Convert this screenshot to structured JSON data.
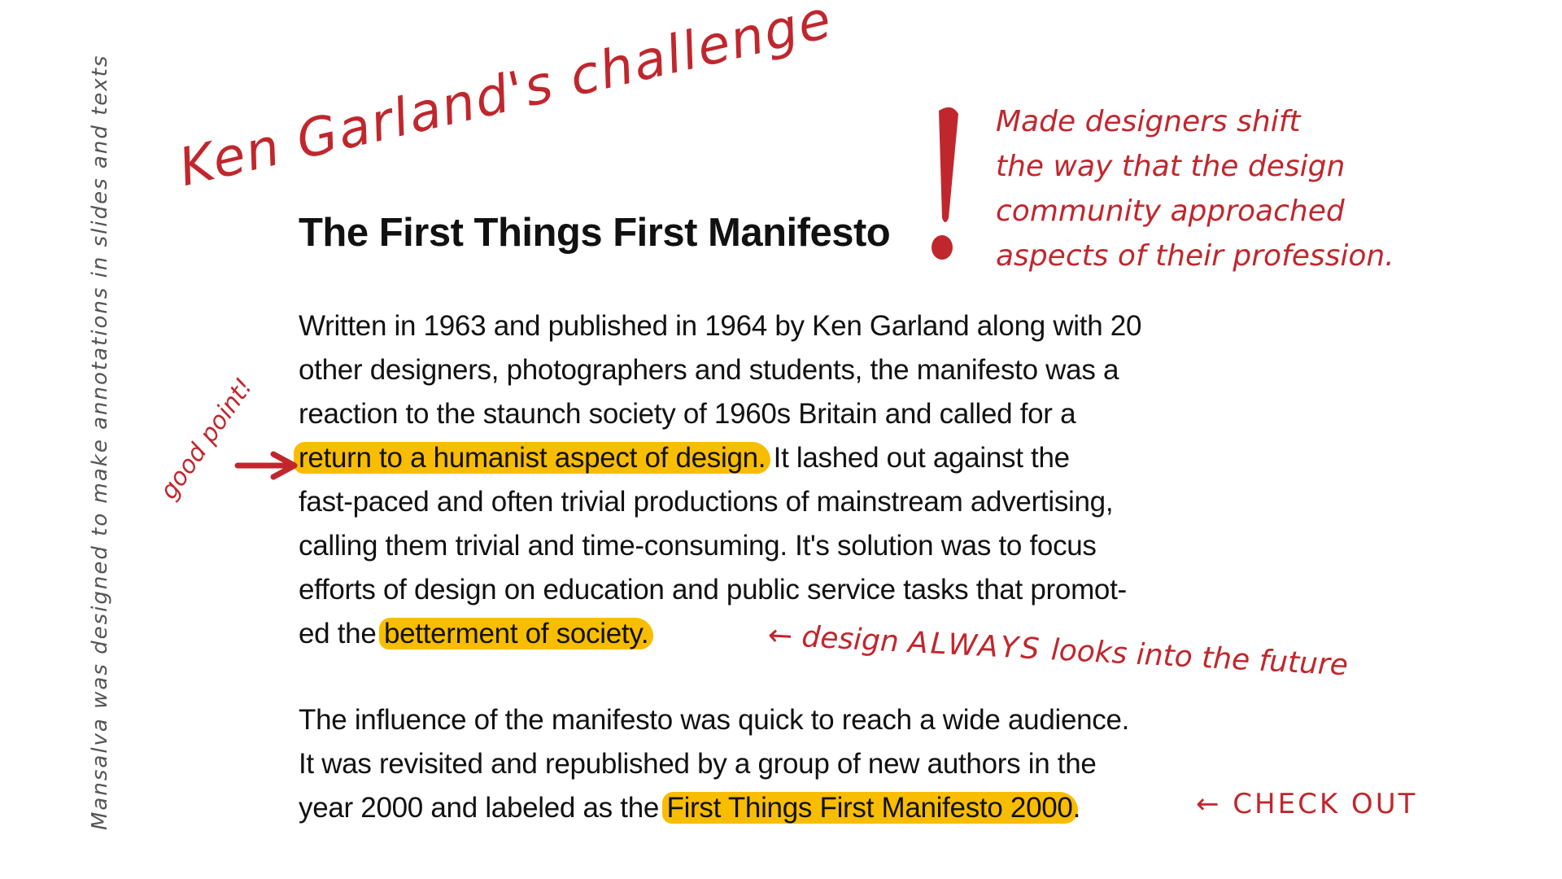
{
  "side_note": "Mansalva was designed to make annotations in slides and texts",
  "handwritten_title": "Ken Garland's challenge",
  "heading": "The First Things First Manifesto",
  "margin_note": {
    "lines": [
      "Made designers shift",
      "the way that the design",
      "community approached",
      "aspects of their profession."
    ]
  },
  "paragraph1": {
    "l1": "Written in 1963 and published in 1964 by Ken Garland along with 20",
    "l2": "other designers, photographers and students, the manifesto was a",
    "l3": "reaction to the staunch society of 1960s Britain and called for a",
    "l4_highlight": "return to a humanist aspect of design.",
    "l4_rest": " It lashed out against the",
    "l5": "fast-paced and often trivial productions of mainstream advertising,",
    "l6": "calling them trivial and time-consuming. It's solution was to focus",
    "l7": "efforts of design on education and public service tasks that promot-",
    "l8_pre": "ed the ",
    "l8_highlight": "betterment of society."
  },
  "paragraph2": {
    "l1": "The influence of the manifesto was quick to reach a wide audience.",
    "l2": "It was revisited and republished by a group of new authors in the",
    "l3_pre": "year 2000 and labeled as the ",
    "l3_highlight": "First Things First Manifesto 2000",
    "l3_post": "."
  },
  "annotations": {
    "good_point": "good point!",
    "future_arrow": "←",
    "future_pre": "design",
    "future_caps": "ALWAYS",
    "future_post": "looks into the future",
    "check_out": "← CHECK OUT"
  },
  "colors": {
    "annotation": "#c0272d",
    "highlight": "#f9bd00",
    "text": "#111111"
  }
}
